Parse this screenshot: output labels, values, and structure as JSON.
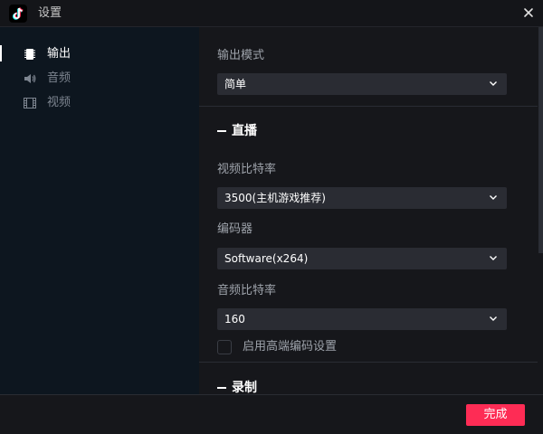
{
  "window": {
    "title": "设置",
    "logo_icon": "tiktok-logo",
    "close_icon": "close-icon"
  },
  "sidebar": {
    "items": [
      {
        "label": "输出",
        "icon": "output-chip-icon",
        "active": true
      },
      {
        "label": "音频",
        "icon": "speaker-icon",
        "active": false
      },
      {
        "label": "视频",
        "icon": "film-icon",
        "active": false
      }
    ]
  },
  "main": {
    "output_mode": {
      "label": "输出模式",
      "value": "简单"
    },
    "live_section": {
      "title": "直播",
      "video_bitrate": {
        "label": "视频比特率",
        "value": "3500(主机游戏推荐)"
      },
      "encoder": {
        "label": "编码器",
        "value": "Software(x264)"
      },
      "audio_bitrate": {
        "label": "音频比特率",
        "value": "160"
      },
      "advanced_checkbox": {
        "label": "启用高端编码设置",
        "checked": false
      }
    },
    "record_section": {
      "title": "录制"
    }
  },
  "footer": {
    "done_label": "完成"
  },
  "colors": {
    "accent": "#fe2c55",
    "sidebar_bg": "#0d161f",
    "main_bg": "#16171b",
    "select_bg": "#2a2c33"
  }
}
